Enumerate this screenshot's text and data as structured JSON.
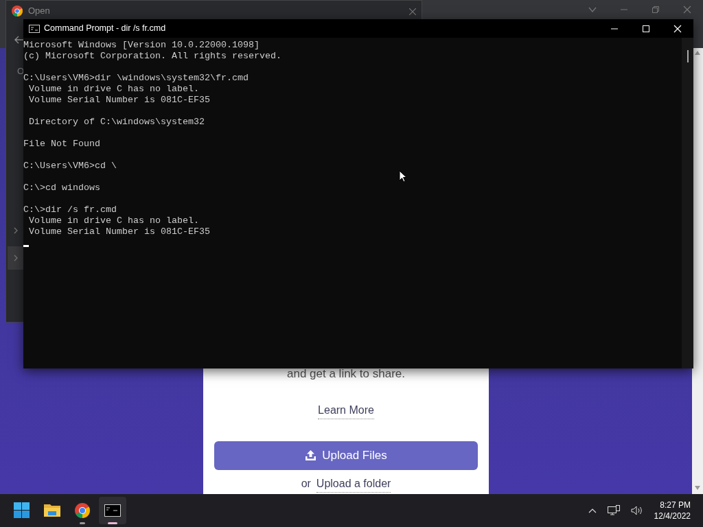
{
  "browser_window": {
    "page": {
      "tagline": "and get a link to share.",
      "learn_more": "Learn More",
      "upload_button": "Upload Files",
      "or_text": "or",
      "upload_folder": "Upload a folder"
    }
  },
  "open_dialog": {
    "title": "Open",
    "text_fragment": "O"
  },
  "console_window": {
    "title": "Command Prompt - dir  /s fr.cmd",
    "blocks": [
      [
        "Microsoft Windows [Version 10.0.22000.1098]",
        "(c) Microsoft Corporation. All rights reserved."
      ],
      [
        "C:\\Users\\VM6>dir \\windows\\system32\\fr.cmd",
        " Volume in drive C has no label.",
        " Volume Serial Number is 081C-EF35"
      ],
      [
        " Directory of C:\\windows\\system32"
      ],
      [
        "File Not Found"
      ],
      [
        "C:\\Users\\VM6>cd \\"
      ],
      [
        "C:\\>cd windows"
      ],
      [
        "C:\\>dir /s fr.cmd",
        " Volume in drive C has no label.",
        " Volume Serial Number is 081C-EF35"
      ]
    ]
  },
  "taskbar": {
    "apps": [
      {
        "kind": "start",
        "running": false,
        "selected": false
      },
      {
        "kind": "files",
        "running": false,
        "selected": false
      },
      {
        "kind": "browser",
        "running": true,
        "selected": false
      },
      {
        "kind": "terminal",
        "running": true,
        "selected": true
      }
    ],
    "time": "8:27 PM",
    "date": "12/4/2022"
  }
}
